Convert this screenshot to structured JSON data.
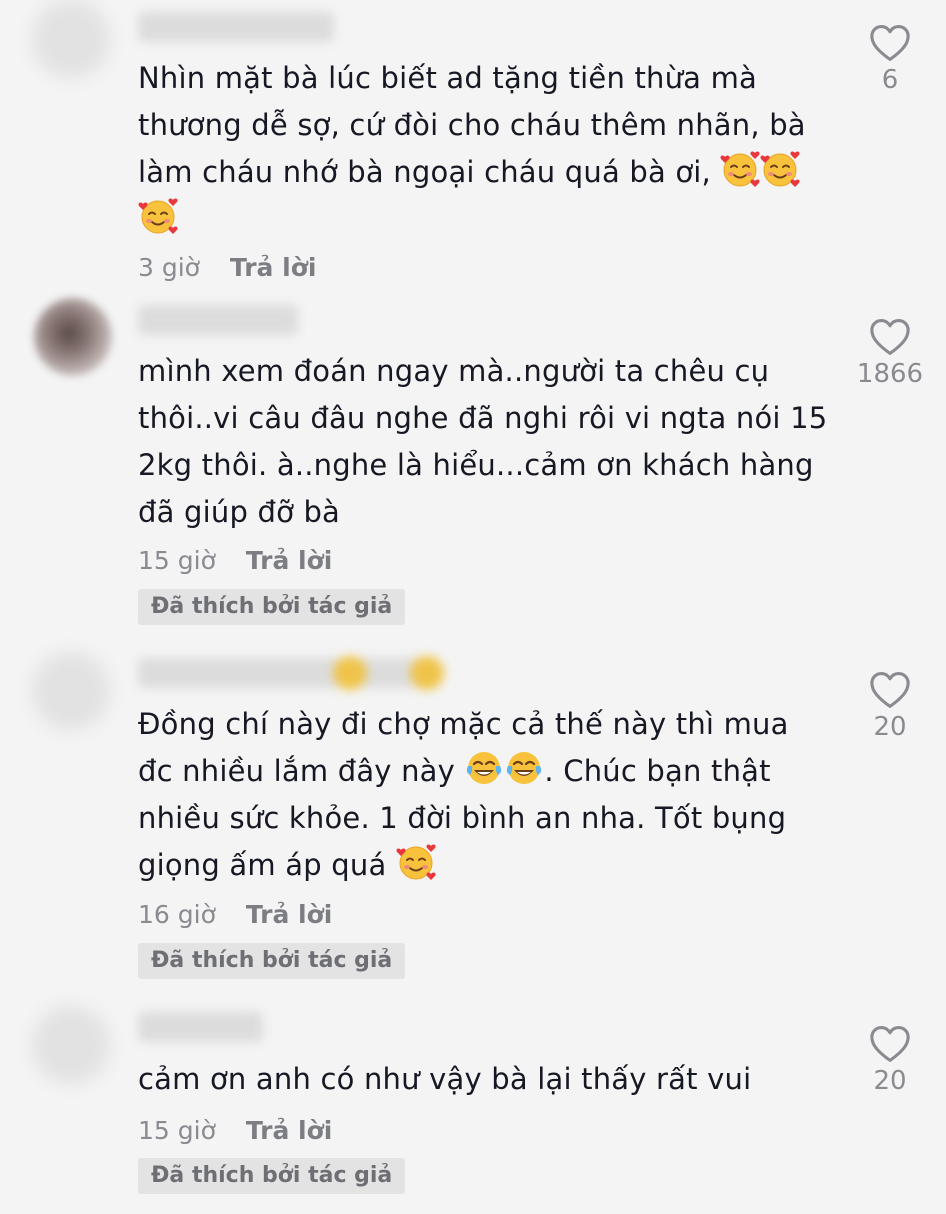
{
  "comments": [
    {
      "text": "Nhìn mặt bà lúc biết ad tặng tiền thừa mà thương dễ sợ, cứ đòi cho cháu thêm nhãn, bà làm cháu nhớ bà ngoại cháu quá bà ơi,",
      "emojis": [
        "smiling-face-with-hearts",
        "smiling-face-with-hearts",
        "smiling-face-with-hearts"
      ],
      "time": "3 giờ",
      "reply_label": "Trả lời",
      "likes": "6"
    },
    {
      "text": "mình xem đoán ngay mà..người ta chêu cụ thôi..vi câu đâu nghe đã nghi rôi vi ngta nói 15 2kg thôi. à..nghe là hiểu...cảm ơn khách hàng đã giúp đỡ bà",
      "time": "15 giờ",
      "reply_label": "Trả lời",
      "liked_by_author": "Đã thích bởi tác giả",
      "likes": "1866"
    },
    {
      "text_before_emoji": "Đồng chí này đi chợ mặc cả thế này thì mua đc nhiều lắm đây này",
      "text_after_emoji": ". Chúc bạn thật nhiều sức khỏe. 1 đời bình an nha. Tốt bụng giọng ấm áp quá",
      "emojis_mid": [
        "face-with-tears-of-joy",
        "face-with-tears-of-joy"
      ],
      "emojis_end": [
        "smiling-face-with-hearts"
      ],
      "time": "16 giờ",
      "reply_label": "Trả lời",
      "liked_by_author": "Đã thích bởi tác giả",
      "likes": "20"
    },
    {
      "text": "cảm ơn anh có như vậy bà lại thấy rất vui",
      "time": "15 giờ",
      "reply_label": "Trả lời",
      "liked_by_author": "Đã thích bởi tác giả",
      "likes": "20"
    }
  ],
  "colors": {
    "background": "#f4f4f4",
    "text": "#161823",
    "muted": "#8a8b91",
    "badge_bg": "#e3e3e4"
  },
  "icons": {
    "like": "heart-outline-icon"
  }
}
